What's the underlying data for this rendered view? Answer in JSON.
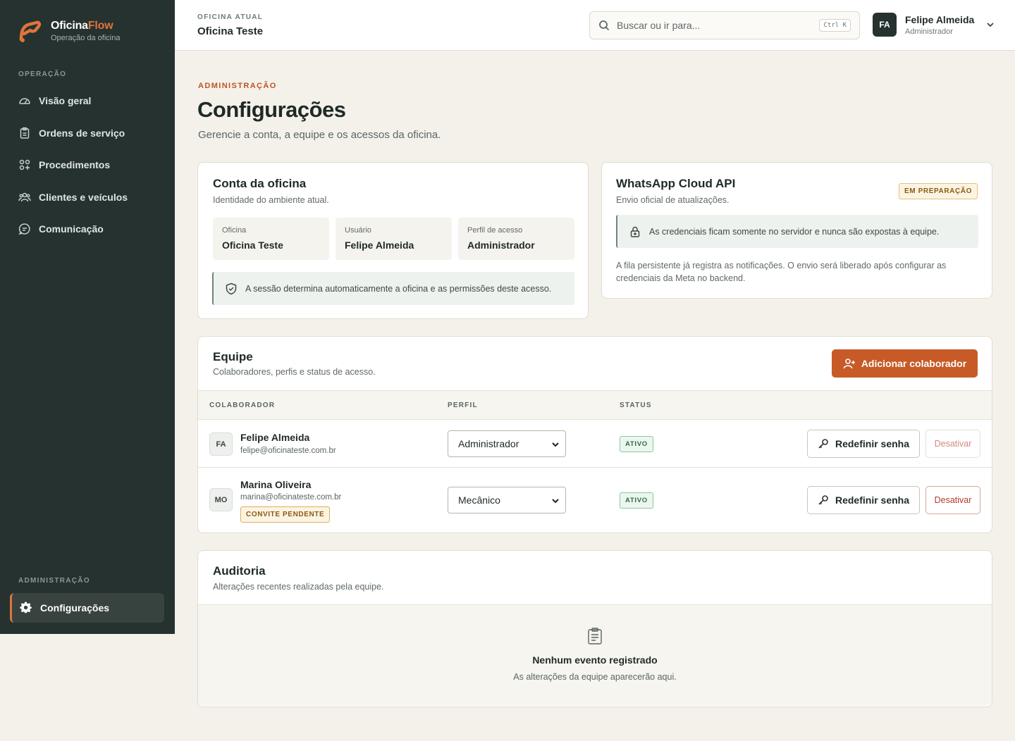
{
  "brand": {
    "name_main": "Oficina",
    "name_accent": "Flow",
    "tagline": "Operação da oficina",
    "accent_color": "#e0743a"
  },
  "sidebar": {
    "section_operation": "OPERAÇÃO",
    "items": [
      {
        "label": "Visão geral",
        "icon": "gauge-icon"
      },
      {
        "label": "Ordens de serviço",
        "icon": "clipboard-icon"
      },
      {
        "label": "Procedimentos",
        "icon": "grid-icon"
      },
      {
        "label": "Clientes e veículos",
        "icon": "users-icon"
      },
      {
        "label": "Comunicação",
        "icon": "chat-icon"
      }
    ],
    "section_admin": "ADMINISTRAÇÃO",
    "active_item": {
      "label": "Configurações",
      "icon": "gear-icon"
    }
  },
  "header": {
    "current_label": "OFICINA ATUAL",
    "current_name": "Oficina Teste",
    "search_placeholder": "Buscar ou ir para...",
    "search_shortcut": "Ctrl K",
    "user_initials": "FA",
    "user_name": "Felipe Almeida",
    "user_role": "Administrador"
  },
  "page": {
    "eyebrow": "ADMINISTRAÇÃO",
    "title": "Configurações",
    "subtitle": "Gerencie a conta, a equipe e os acessos da oficina."
  },
  "account": {
    "title": "Conta da oficina",
    "subtitle": "Identidade do ambiente atual.",
    "fields": [
      {
        "label": "Oficina",
        "value": "Oficina Teste"
      },
      {
        "label": "Usuário",
        "value": "Felipe Almeida"
      },
      {
        "label": "Perfil de acesso",
        "value": "Administrador"
      }
    ],
    "note": "A sessão determina automaticamente a oficina e as permissões deste acesso."
  },
  "whatsapp": {
    "title": "WhatsApp Cloud API",
    "subtitle": "Envio oficial de atualizações.",
    "badge": "EM PREPARAÇÃO",
    "note": "As credenciais ficam somente no servidor e nunca são expostas à equipe.",
    "body": "A fila persistente já registra as notificações. O envio será liberado após configurar as credenciais da Meta no backend."
  },
  "team": {
    "title": "Equipe",
    "subtitle": "Colaboradores, perfis e status de acesso.",
    "add_button": "Adicionar colaborador",
    "columns": {
      "collaborator": "COLABORADOR",
      "profile": "PERFIL",
      "status": "STATUS"
    },
    "rows": [
      {
        "initials": "FA",
        "name": "Felipe Almeida",
        "email": "felipe@oficinateste.com.br",
        "profile": "Administrador",
        "status": "ATIVO",
        "reset": "Redefinir senha",
        "deactivate": "Desativar"
      },
      {
        "initials": "MO",
        "name": "Marina Oliveira",
        "email": "marina@oficinateste.com.br",
        "invite": "CONVITE PENDENTE",
        "profile": "Mecânico",
        "status": "ATIVO",
        "reset": "Redefinir senha",
        "deactivate": "Desativar"
      }
    ]
  },
  "audit": {
    "title": "Auditoria",
    "subtitle": "Alterações recentes realizadas pela equipe.",
    "empty_title": "Nenhum evento registrado",
    "empty_sub": "As alterações da equipe aparecerão aqui."
  }
}
